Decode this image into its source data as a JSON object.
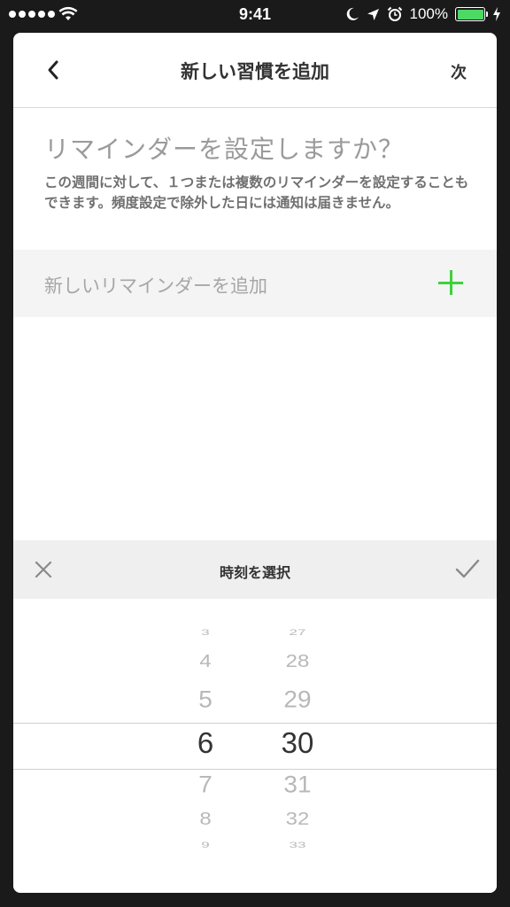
{
  "status_bar": {
    "time": "9:41",
    "battery": "100%"
  },
  "nav": {
    "title": "新しい習慣を追加",
    "next_label": "次"
  },
  "content": {
    "question": "リマインダーを設定しますか？",
    "description": "この週間に対して、１つまたは複数のリマインダーを設定することもできます。頻度設定で除外した日には通知は届きません。",
    "add_reminder_label": "新しいリマインダーを追加"
  },
  "picker": {
    "title": "時刻を選択",
    "hours": [
      "3",
      "4",
      "5",
      "6",
      "7",
      "8",
      "9"
    ],
    "minutes": [
      "27",
      "28",
      "29",
      "30",
      "31",
      "32",
      "33"
    ],
    "selected_hour": "6",
    "selected_minute": "30"
  },
  "colors": {
    "accent_green": "#3dd13d",
    "battery_green": "#4cd964"
  }
}
